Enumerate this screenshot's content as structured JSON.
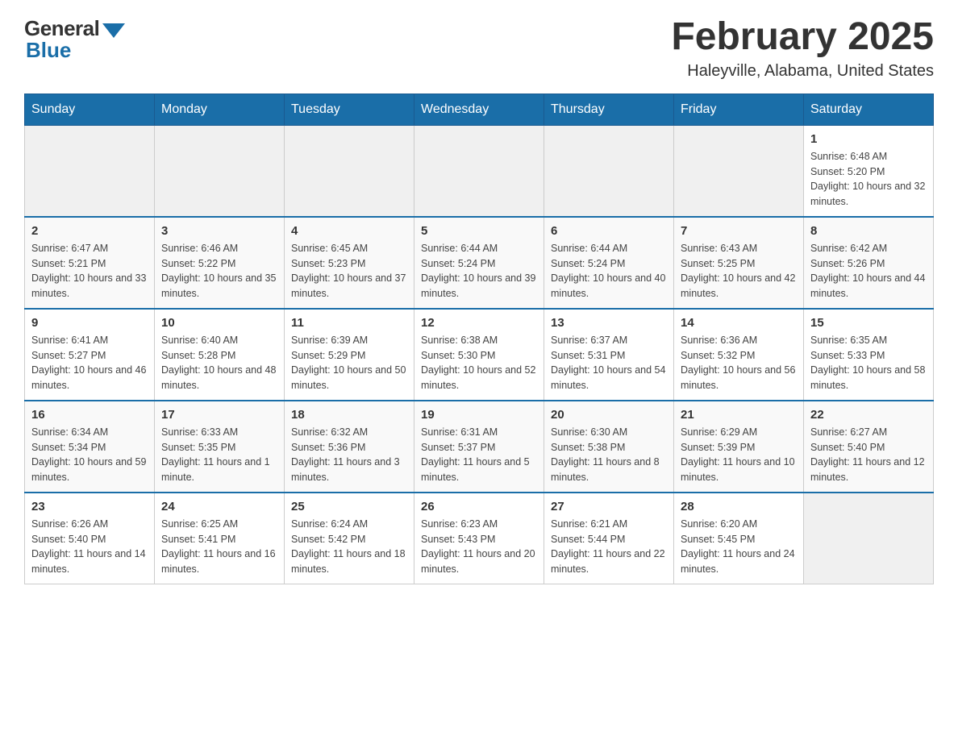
{
  "header": {
    "logo_general": "General",
    "logo_blue": "Blue",
    "month_title": "February 2025",
    "location": "Haleyville, Alabama, United States"
  },
  "weekdays": [
    "Sunday",
    "Monday",
    "Tuesday",
    "Wednesday",
    "Thursday",
    "Friday",
    "Saturday"
  ],
  "weeks": [
    [
      {
        "day": "",
        "info": ""
      },
      {
        "day": "",
        "info": ""
      },
      {
        "day": "",
        "info": ""
      },
      {
        "day": "",
        "info": ""
      },
      {
        "day": "",
        "info": ""
      },
      {
        "day": "",
        "info": ""
      },
      {
        "day": "1",
        "info": "Sunrise: 6:48 AM\nSunset: 5:20 PM\nDaylight: 10 hours and 32 minutes."
      }
    ],
    [
      {
        "day": "2",
        "info": "Sunrise: 6:47 AM\nSunset: 5:21 PM\nDaylight: 10 hours and 33 minutes."
      },
      {
        "day": "3",
        "info": "Sunrise: 6:46 AM\nSunset: 5:22 PM\nDaylight: 10 hours and 35 minutes."
      },
      {
        "day": "4",
        "info": "Sunrise: 6:45 AM\nSunset: 5:23 PM\nDaylight: 10 hours and 37 minutes."
      },
      {
        "day": "5",
        "info": "Sunrise: 6:44 AM\nSunset: 5:24 PM\nDaylight: 10 hours and 39 minutes."
      },
      {
        "day": "6",
        "info": "Sunrise: 6:44 AM\nSunset: 5:24 PM\nDaylight: 10 hours and 40 minutes."
      },
      {
        "day": "7",
        "info": "Sunrise: 6:43 AM\nSunset: 5:25 PM\nDaylight: 10 hours and 42 minutes."
      },
      {
        "day": "8",
        "info": "Sunrise: 6:42 AM\nSunset: 5:26 PM\nDaylight: 10 hours and 44 minutes."
      }
    ],
    [
      {
        "day": "9",
        "info": "Sunrise: 6:41 AM\nSunset: 5:27 PM\nDaylight: 10 hours and 46 minutes."
      },
      {
        "day": "10",
        "info": "Sunrise: 6:40 AM\nSunset: 5:28 PM\nDaylight: 10 hours and 48 minutes."
      },
      {
        "day": "11",
        "info": "Sunrise: 6:39 AM\nSunset: 5:29 PM\nDaylight: 10 hours and 50 minutes."
      },
      {
        "day": "12",
        "info": "Sunrise: 6:38 AM\nSunset: 5:30 PM\nDaylight: 10 hours and 52 minutes."
      },
      {
        "day": "13",
        "info": "Sunrise: 6:37 AM\nSunset: 5:31 PM\nDaylight: 10 hours and 54 minutes."
      },
      {
        "day": "14",
        "info": "Sunrise: 6:36 AM\nSunset: 5:32 PM\nDaylight: 10 hours and 56 minutes."
      },
      {
        "day": "15",
        "info": "Sunrise: 6:35 AM\nSunset: 5:33 PM\nDaylight: 10 hours and 58 minutes."
      }
    ],
    [
      {
        "day": "16",
        "info": "Sunrise: 6:34 AM\nSunset: 5:34 PM\nDaylight: 10 hours and 59 minutes."
      },
      {
        "day": "17",
        "info": "Sunrise: 6:33 AM\nSunset: 5:35 PM\nDaylight: 11 hours and 1 minute."
      },
      {
        "day": "18",
        "info": "Sunrise: 6:32 AM\nSunset: 5:36 PM\nDaylight: 11 hours and 3 minutes."
      },
      {
        "day": "19",
        "info": "Sunrise: 6:31 AM\nSunset: 5:37 PM\nDaylight: 11 hours and 5 minutes."
      },
      {
        "day": "20",
        "info": "Sunrise: 6:30 AM\nSunset: 5:38 PM\nDaylight: 11 hours and 8 minutes."
      },
      {
        "day": "21",
        "info": "Sunrise: 6:29 AM\nSunset: 5:39 PM\nDaylight: 11 hours and 10 minutes."
      },
      {
        "day": "22",
        "info": "Sunrise: 6:27 AM\nSunset: 5:40 PM\nDaylight: 11 hours and 12 minutes."
      }
    ],
    [
      {
        "day": "23",
        "info": "Sunrise: 6:26 AM\nSunset: 5:40 PM\nDaylight: 11 hours and 14 minutes."
      },
      {
        "day": "24",
        "info": "Sunrise: 6:25 AM\nSunset: 5:41 PM\nDaylight: 11 hours and 16 minutes."
      },
      {
        "day": "25",
        "info": "Sunrise: 6:24 AM\nSunset: 5:42 PM\nDaylight: 11 hours and 18 minutes."
      },
      {
        "day": "26",
        "info": "Sunrise: 6:23 AM\nSunset: 5:43 PM\nDaylight: 11 hours and 20 minutes."
      },
      {
        "day": "27",
        "info": "Sunrise: 6:21 AM\nSunset: 5:44 PM\nDaylight: 11 hours and 22 minutes."
      },
      {
        "day": "28",
        "info": "Sunrise: 6:20 AM\nSunset: 5:45 PM\nDaylight: 11 hours and 24 minutes."
      },
      {
        "day": "",
        "info": ""
      }
    ]
  ]
}
